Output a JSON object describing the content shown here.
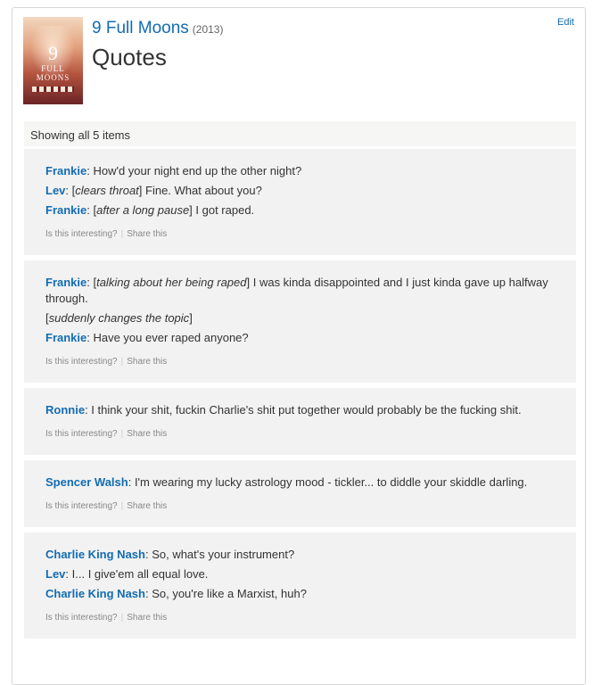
{
  "header": {
    "edit_label": "Edit",
    "title": "9 Full Moons",
    "year": "(2013)",
    "page_title": "Quotes",
    "poster": {
      "number": "9",
      "word1": "FULL",
      "word2": "MOONS"
    }
  },
  "list": {
    "showing_text": "Showing all 5 items"
  },
  "quotes": [
    {
      "lines": [
        {
          "speaker": "Frankie",
          "pre": ": How'd your night end up the other night?",
          "action": "",
          "post": ""
        },
        {
          "speaker": "Lev",
          "pre": ": [",
          "action": "clears throat",
          "post": "] Fine. What about you?"
        },
        {
          "speaker": "Frankie",
          "pre": ": [",
          "action": "after a long pause",
          "post": "] I got raped."
        }
      ]
    },
    {
      "lines": [
        {
          "speaker": "Frankie",
          "pre": ": [",
          "action": "talking about her being raped",
          "post": "] I was kinda disappointed and I just kinda gave up halfway through."
        },
        {
          "speaker": "",
          "pre": "[",
          "action": "suddenly changes the topic",
          "post": "]"
        },
        {
          "speaker": "Frankie",
          "pre": ": Have you ever raped anyone?",
          "action": "",
          "post": ""
        }
      ]
    },
    {
      "lines": [
        {
          "speaker": "Ronnie",
          "pre": ": I think your shit, fuckin Charlie's shit put together would probably be the fucking shit.",
          "action": "",
          "post": ""
        }
      ]
    },
    {
      "lines": [
        {
          "speaker": "Spencer Walsh",
          "pre": ": I'm wearing my lucky astrology mood - tickler... to diddle your skiddle darling.",
          "action": "",
          "post": ""
        }
      ]
    },
    {
      "lines": [
        {
          "speaker": "Charlie King Nash",
          "pre": ": So, what's your instrument?",
          "action": "",
          "post": ""
        },
        {
          "speaker": "Lev",
          "pre": ": I... I give'em all equal love.",
          "action": "",
          "post": ""
        },
        {
          "speaker": "Charlie King Nash",
          "pre": ": So, you're like a Marxist, huh?",
          "action": "",
          "post": ""
        }
      ]
    }
  ],
  "quote_actions": {
    "interesting_label": "Is this interesting?",
    "separator": "|",
    "share_label": "Share this"
  },
  "colors": {
    "link": "#136cb2",
    "quote_bg": "#f2f2f2",
    "showing_bg": "#f6f6f5"
  }
}
